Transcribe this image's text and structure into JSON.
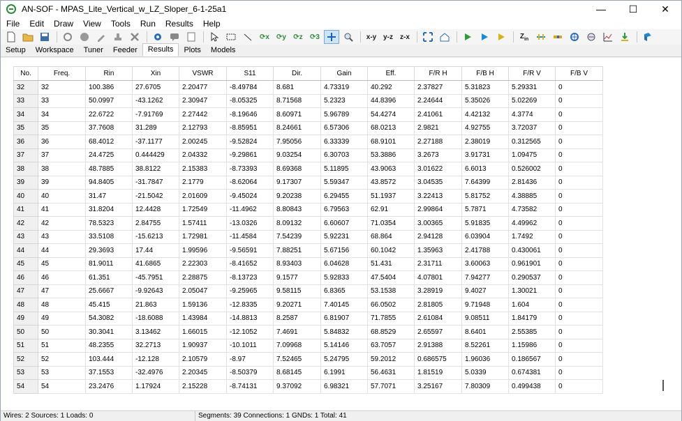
{
  "window": {
    "title": "AN-SOF - MPAS_Lite_Vertical_w_LZ_Sloper_6-1-25a1"
  },
  "menu": [
    "File",
    "Edit",
    "Draw",
    "View",
    "Tools",
    "Run",
    "Results",
    "Help"
  ],
  "toolbar": {
    "xy_label": "x-y",
    "yz_label": "y-z",
    "zx_label": "z-x"
  },
  "tabs": [
    "Setup",
    "Workspace",
    "Tuner",
    "Feeder",
    "Results",
    "Plots",
    "Models"
  ],
  "grid": {
    "columns": [
      "No.",
      "Freq.",
      "Rin",
      "Xin",
      "VSWR",
      "S11",
      "Dir.",
      "Gain",
      "Eff.",
      "F/R  H",
      "F/B  H",
      "F/R  V",
      "F/B  V"
    ],
    "rows": [
      [
        "32",
        "32",
        "100.386",
        "27.6705",
        "2.20477",
        "-8.49784",
        "8.681",
        "4.73319",
        "40.292",
        "2.37827",
        "5.31823",
        "5.29331",
        "0"
      ],
      [
        "33",
        "33",
        "50.0997",
        "-43.1262",
        "2.30947",
        "-8.05325",
        "8.71568",
        "5.2323",
        "44.8396",
        "2.24644",
        "5.35026",
        "5.02269",
        "0"
      ],
      [
        "34",
        "34",
        "22.6722",
        "-7.91769",
        "2.27442",
        "-8.19646",
        "8.60971",
        "5.96789",
        "54.4274",
        "2.41061",
        "4.42132",
        "4.3774",
        "0"
      ],
      [
        "35",
        "35",
        "37.7608",
        "31.289",
        "2.12793",
        "-8.85951",
        "8.24661",
        "6.57306",
        "68.0213",
        "2.9821",
        "4.92755",
        "3.72037",
        "0"
      ],
      [
        "36",
        "36",
        "68.4012",
        "-37.1177",
        "2.00245",
        "-9.52824",
        "7.95056",
        "6.33339",
        "68.9101",
        "2.27188",
        "2.38019",
        "0.312565",
        "0"
      ],
      [
        "37",
        "37",
        "24.4725",
        "0.444429",
        "2.04332",
        "-9.29861",
        "9.03254",
        "6.30703",
        "53.3886",
        "3.2673",
        "3.91731",
        "1.09475",
        "0"
      ],
      [
        "38",
        "38",
        "48.7885",
        "38.8122",
        "2.15383",
        "-8.73393",
        "8.69368",
        "5.11895",
        "43.9063",
        "3.01622",
        "6.6013",
        "0.526002",
        "0"
      ],
      [
        "39",
        "39",
        "94.8405",
        "-31.7847",
        "2.1779",
        "-8.62064",
        "9.17307",
        "5.59347",
        "43.8572",
        "3.04535",
        "7.64399",
        "2.81436",
        "0"
      ],
      [
        "40",
        "40",
        "31.47",
        "-21.5042",
        "2.01609",
        "-9.45024",
        "9.20238",
        "6.29455",
        "51.1937",
        "3.22413",
        "5.81752",
        "4.38885",
        "0"
      ],
      [
        "41",
        "41",
        "31.8204",
        "12.4428",
        "1.72549",
        "-11.4962",
        "8.80843",
        "6.79563",
        "62.91",
        "2.99864",
        "5.7871",
        "4.73582",
        "0"
      ],
      [
        "42",
        "42",
        "78.5323",
        "2.84755",
        "1.57411",
        "-13.0326",
        "8.09132",
        "6.60607",
        "71.0354",
        "3.00365",
        "5.91835",
        "4.49962",
        "0"
      ],
      [
        "43",
        "43",
        "33.5108",
        "-15.6213",
        "1.72981",
        "-11.4584",
        "7.54239",
        "5.92231",
        "68.864",
        "2.94128",
        "6.03904",
        "1.7492",
        "0"
      ],
      [
        "44",
        "44",
        "29.3693",
        "17.44",
        "1.99596",
        "-9.56591",
        "7.88251",
        "5.67156",
        "60.1042",
        "1.35963",
        "2.41788",
        "0.430061",
        "0"
      ],
      [
        "45",
        "45",
        "81.9011",
        "41.6865",
        "2.22303",
        "-8.41652",
        "8.93403",
        "6.04628",
        "51.431",
        "2.31711",
        "3.60063",
        "0.961901",
        "0"
      ],
      [
        "46",
        "46",
        "61.351",
        "-45.7951",
        "2.28875",
        "-8.13723",
        "9.1577",
        "5.92833",
        "47.5404",
        "4.07801",
        "7.94277",
        "0.290537",
        "0"
      ],
      [
        "47",
        "47",
        "25.6667",
        "-9.92643",
        "2.05047",
        "-9.25965",
        "9.58115",
        "6.8365",
        "53.1538",
        "3.28919",
        "9.4027",
        "1.30021",
        "0"
      ],
      [
        "48",
        "48",
        "45.415",
        "21.863",
        "1.59136",
        "-12.8335",
        "9.20271",
        "7.40145",
        "66.0502",
        "2.81805",
        "9.71948",
        "1.604",
        "0"
      ],
      [
        "49",
        "49",
        "54.3082",
        "-18.6088",
        "1.43984",
        "-14.8813",
        "8.2587",
        "6.81907",
        "71.7855",
        "2.61084",
        "9.08511",
        "1.84179",
        "0"
      ],
      [
        "50",
        "50",
        "30.3041",
        "3.13462",
        "1.66015",
        "-12.1052",
        "7.4691",
        "5.84832",
        "68.8529",
        "2.65597",
        "8.6401",
        "2.55385",
        "0"
      ],
      [
        "51",
        "51",
        "48.2355",
        "32.2713",
        "1.90937",
        "-10.1011",
        "7.09968",
        "5.14146",
        "63.7057",
        "2.91388",
        "8.52261",
        "1.15986",
        "0"
      ],
      [
        "52",
        "52",
        "103.444",
        "-12.128",
        "2.10579",
        "-8.97",
        "7.52465",
        "5.24795",
        "59.2012",
        "0.686575",
        "1.96036",
        "0.186567",
        "0"
      ],
      [
        "53",
        "53",
        "37.1553",
        "-32.4976",
        "2.20345",
        "-8.50379",
        "8.68145",
        "6.1991",
        "56.4631",
        "1.81519",
        "5.0339",
        "0.674381",
        "0"
      ],
      [
        "54",
        "54",
        "23.2476",
        "1.17924",
        "2.15228",
        "-8.74131",
        "9.37092",
        "6.98321",
        "57.7071",
        "3.25167",
        "7.80309",
        "0.499438",
        "0"
      ]
    ]
  },
  "status": {
    "left": "Wires: 2  Sources: 1  Loads: 0",
    "right": "Segments: 39  Connections: 1  GNDs: 1  Total: 41"
  }
}
